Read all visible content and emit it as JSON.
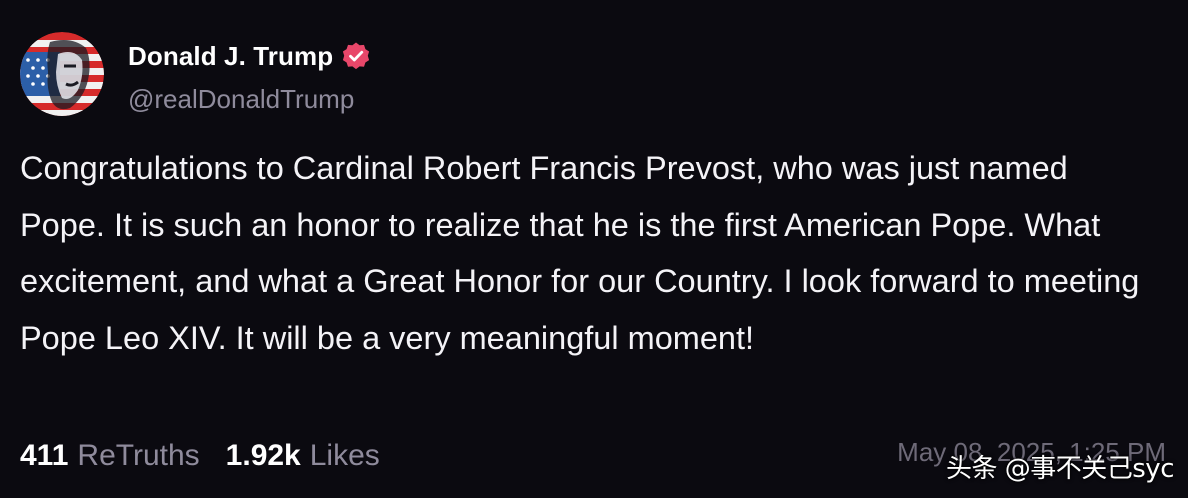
{
  "author": {
    "display_name": "Donald J. Trump",
    "handle": "@realDonaldTrump",
    "verified_icon": "verified-badge-icon",
    "verified_color": "#e8476a"
  },
  "post": {
    "text": "Congratulations to Cardinal Robert Francis Prevost, who was just named Pope. It is such an honor to realize that he is the first American Pope. What excitement, and what a Great Honor for our Country. I look forward to meeting Pope Leo XIV. It will be a very meaningful moment!"
  },
  "stats": {
    "retruths_count": "411",
    "retruths_label": "ReTruths",
    "likes_count": "1.92k",
    "likes_label": "Likes"
  },
  "timestamp": "May 08, 2025, 1:25 PM",
  "watermark": "头条 @事不关己syc",
  "colors": {
    "background": "#0b0a10",
    "text": "#f4f3f7",
    "muted": "#8f8b9c"
  }
}
